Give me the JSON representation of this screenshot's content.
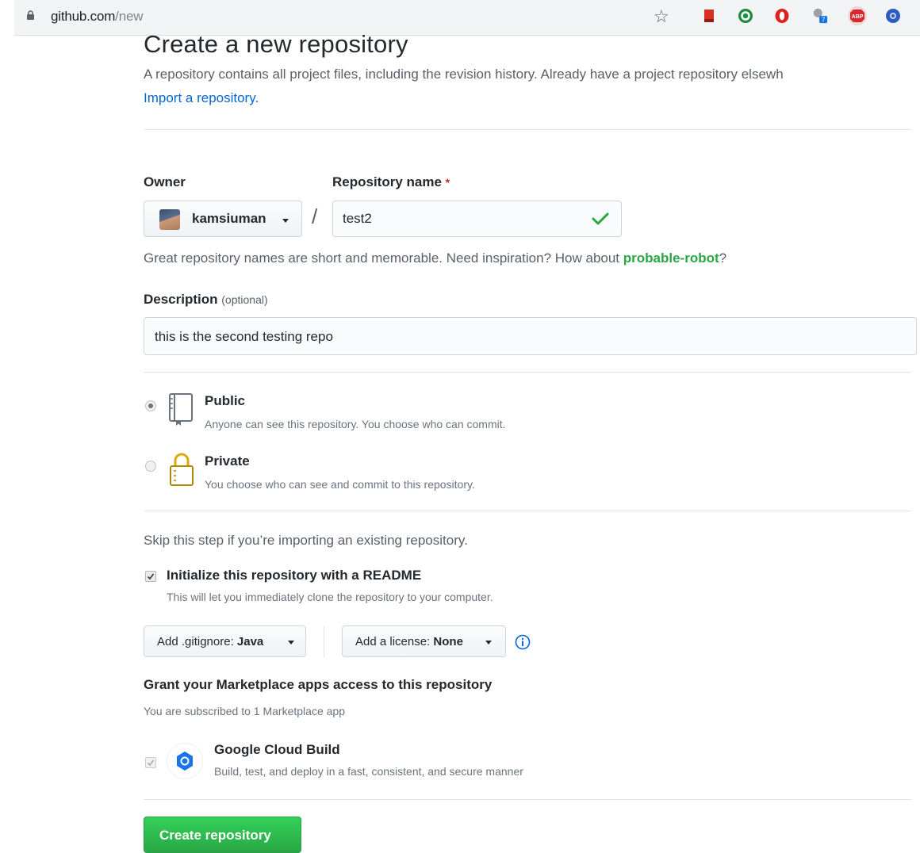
{
  "browser": {
    "url_host": "github.com",
    "url_path": "/new",
    "extensions": [
      {
        "icon": "bookmark-ext-icon",
        "color": "#d93025"
      },
      {
        "icon": "green-circle-ext-icon",
        "color": "#1e8e3e"
      },
      {
        "icon": "opera-ext-icon",
        "color": "#e0201f"
      },
      {
        "icon": "gray-ext-icon",
        "color": "#9aa0a6",
        "badge": "7"
      },
      {
        "icon": "adblock-plus-icon",
        "color": "#d5292e",
        "label": "ABP"
      },
      {
        "icon": "blue-globe-ext-icon",
        "color": "#2b5cbf"
      }
    ]
  },
  "header": {
    "title": "Create a new repository",
    "description": "A repository contains all project files, including the revision history. Already have a project repository elsewh",
    "import_link": "Import a repository."
  },
  "form": {
    "owner_label": "Owner",
    "owner_value": "kamsiuman",
    "repo_label": "Repository name",
    "required_mark": "*",
    "separator": "/",
    "repo_value": "test2",
    "hint_prefix": "Great repository names are short and memorable. Need inspiration? How about ",
    "hint_suggestion": "probable-robot",
    "hint_suffix": "?",
    "description_label": "Description",
    "description_optional": "(optional)",
    "description_value": "this is the second testing repo"
  },
  "visibility": {
    "public_title": "Public",
    "public_note": "Anyone can see this repository. You choose who can commit.",
    "public_selected": true,
    "private_title": "Private",
    "private_note": "You choose who can see and commit to this repository.",
    "private_selected": false
  },
  "init": {
    "skip_text": "Skip this step if you’re importing an existing repository.",
    "readme_label": "Initialize this repository with a README",
    "readme_checked": true,
    "readme_note": "This will let you immediately clone the repository to your computer.",
    "gitignore_prefix": "Add .gitignore:",
    "gitignore_value": "Java",
    "license_prefix": "Add a license:",
    "license_value": "None"
  },
  "marketplace": {
    "title": "Grant your Marketplace apps access to this repository",
    "note": "You are subscribed to 1 Marketplace app",
    "app_name": "Google Cloud Build",
    "app_desc": "Build, test, and deploy in a fast, consistent, and secure manner",
    "app_checked": true
  },
  "submit": {
    "label": "Create repository"
  },
  "colors": {
    "accent_green": "#28a745",
    "link_blue": "#0366d6",
    "required_red": "#cb2431"
  }
}
